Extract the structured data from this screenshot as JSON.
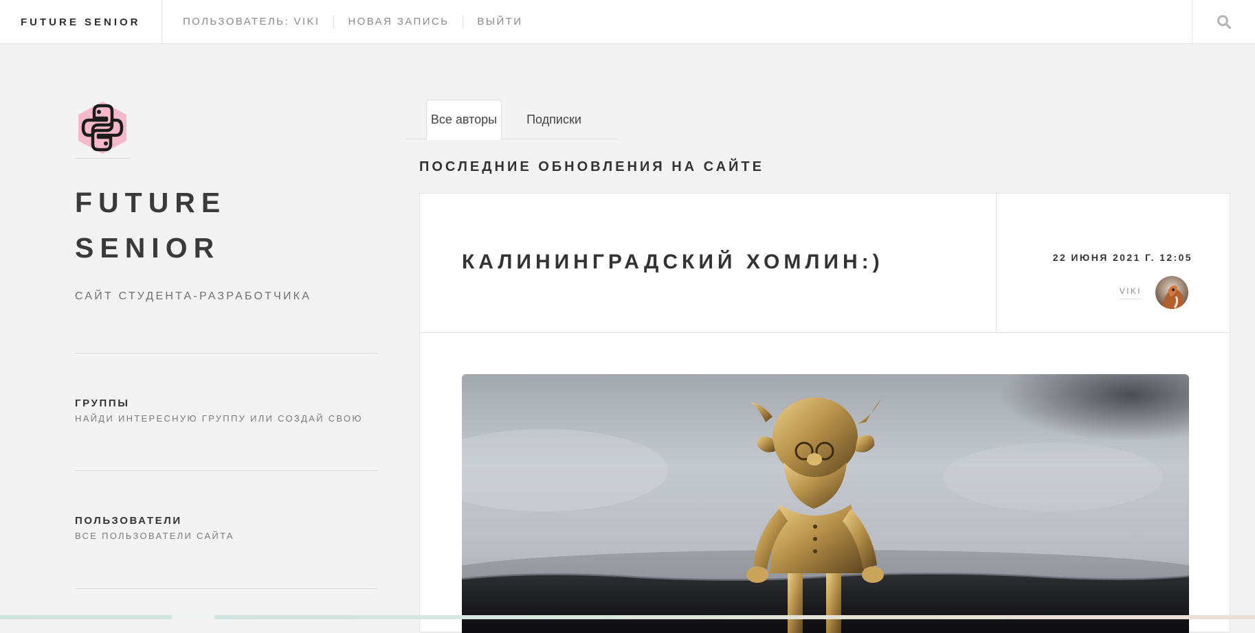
{
  "topbar": {
    "brand": "FUTURE SENIOR",
    "nav": [
      {
        "label": "ПОЛЬЗОВАТЕЛЬ: VIKI"
      },
      {
        "label": "НОВАЯ ЗАПИСЬ"
      },
      {
        "label": "ВЫЙТИ"
      }
    ],
    "search_icon": "search-icon"
  },
  "sidebar": {
    "logo_icon": "python-logo",
    "title_line1": "FUTURE",
    "title_line2": "SENIOR",
    "subtitle": "САЙТ СТУДЕНТА-РАЗРАБОТЧИКА",
    "links": [
      {
        "title": "ГРУППЫ",
        "desc": "НАЙДИ ИНТЕРЕСНУЮ ГРУППУ ИЛИ СОЗДАЙ СВОЮ"
      },
      {
        "title": "ПОЛЬЗОВАТЕЛИ",
        "desc": "ВСЕ ПОЛЬЗОВАТЕЛИ САЙТА"
      }
    ]
  },
  "main": {
    "tabs": [
      {
        "label": "Все авторы",
        "active": true
      },
      {
        "label": "Подписки",
        "active": false
      }
    ],
    "heading": "ПОСЛЕДНИЕ ОБНОВЛЕНИЯ НА САЙТЕ",
    "post": {
      "title": "КАЛИНИНГРАДСКИЙ ХОМЛИН:)",
      "date": "22 ИЮНЯ 2021 Г. 12:05",
      "author": "VIKI",
      "avatar_icon": "user-avatar",
      "image_icon": "gnome-figurine-photo"
    }
  },
  "colors": {
    "page_bg": "#f3f3f3",
    "card_bg": "#ffffff",
    "text_dark": "#333333",
    "text_muted": "#8a8a8a",
    "logo_pink": "#f6b8cb"
  }
}
